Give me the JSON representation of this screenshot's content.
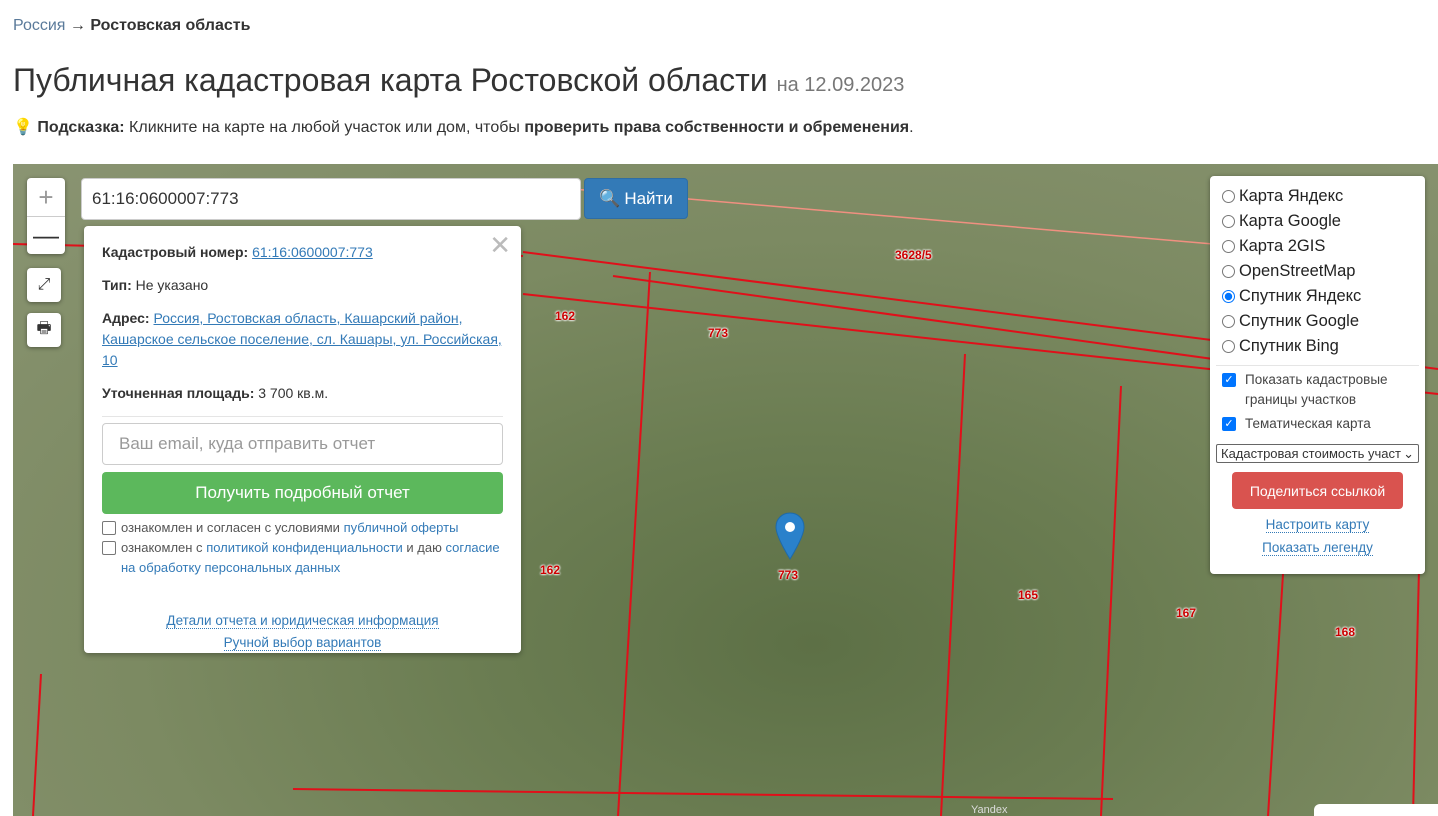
{
  "breadcrumb": {
    "root": "Россия",
    "arrow": "→",
    "current": "Ростовская область"
  },
  "title": "Публичная кадастровая карта Ростовской области",
  "date": "на 12.09.2023",
  "hint": {
    "label": "Подсказка:",
    "text1": "Кликните на карте на любой участок или дом, чтобы",
    "strong": "проверить права собственности и обременения",
    "end": "."
  },
  "map": {
    "zoom_in": "+",
    "zoom_out": "—",
    "search_value": "61:16:0600007:773",
    "find_label": "Найти",
    "parcel_labels": [
      "3628/5",
      "162",
      "773",
      "162",
      "773",
      "165",
      "167",
      "168"
    ],
    "watermark": "Yandex"
  },
  "popup": {
    "cad_label": "Кадастровый номер:",
    "cad_value": "61:16:0600007:773",
    "type_label": "Тип:",
    "type_value": "Не указано",
    "address_label": "Адрес:",
    "address_value": "Россия, Ростовская область, Кашарский район, Кашарское сельское поселение, сл. Кашары, ул. Российская, 10",
    "area_label": "Уточненная площадь:",
    "area_value": "3 700 кв.м.",
    "email_placeholder": "Ваш email, куда отправить отчет",
    "report_button": "Получить подробный отчет",
    "check1_text": "ознакомлен и согласен с условиями",
    "check1_link": "публичной оферты",
    "check2_text": "ознакомлен с",
    "check2_link": "политикой конфиденциальности",
    "check2_mid": "и даю",
    "check2_link2": "согласие на обработку персональных данных",
    "link_details": "Детали отчета и юридическая информация",
    "link_manual": "Ручной выбор вариантов"
  },
  "layers": {
    "options": [
      "Карта Яндекс",
      "Карта Google",
      "Карта 2GIS",
      "OpenStreetMap",
      "Спутник Яндекс",
      "Спутник Google",
      "Спутник Bing"
    ],
    "selected": "Спутник Яндекс",
    "show_borders": "Показать кадастровые границы участков",
    "thematic": "Тематическая карта",
    "select_value": "Кадастровая стоимость участков",
    "share": "Поделиться ссылкой",
    "configure": "Настроить карту",
    "legend": "Показать легенду"
  }
}
